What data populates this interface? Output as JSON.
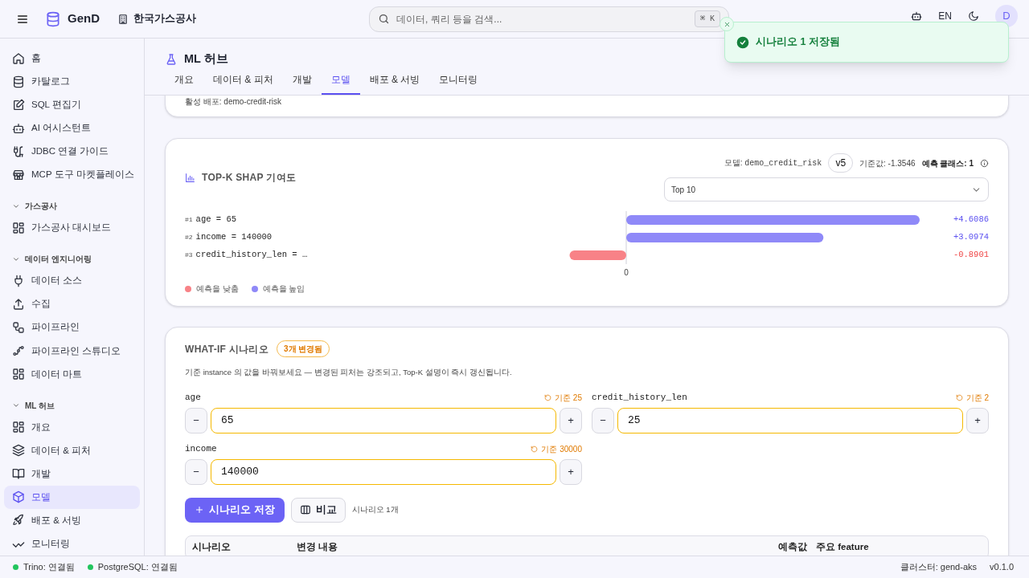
{
  "topbar": {
    "brand": "GenD",
    "org": "한국가스공사",
    "search": {
      "placeholder": "데이터, 쿼리 등을 검색...",
      "shortcut": "⌘ K"
    },
    "language": "EN",
    "avatar": "D"
  },
  "toast": {
    "message": "시나리오 1 저장됨"
  },
  "sidebar": {
    "items": [
      {
        "label": "홈",
        "selected": false
      },
      {
        "label": "카탈로그",
        "selected": false
      },
      {
        "label": "SQL 편집기",
        "selected": false
      },
      {
        "label": "AI 어시스턴트",
        "selected": false
      },
      {
        "label": "JDBC 연결 가이드",
        "selected": false
      },
      {
        "label": "MCP 도구 마켓플레이스",
        "selected": false
      }
    ],
    "sections": [
      {
        "title": "가스공사",
        "expanded": true,
        "items": [
          {
            "label": "가스공사 대시보드",
            "selected": false
          }
        ]
      },
      {
        "title": "데이터 엔지니어링",
        "expanded": true,
        "items": [
          {
            "label": "데이터 소스",
            "selected": false
          },
          {
            "label": "수집",
            "selected": false
          },
          {
            "label": "파이프라인",
            "selected": false
          },
          {
            "label": "파이프라인 스튜디오",
            "selected": false
          },
          {
            "label": "데이터 마트",
            "selected": false
          }
        ]
      },
      {
        "title": "ML 허브",
        "expanded": true,
        "items": [
          {
            "label": "개요",
            "selected": false
          },
          {
            "label": "데이터 & 피처",
            "selected": false
          },
          {
            "label": "개발",
            "selected": false
          },
          {
            "label": "모델",
            "selected": true
          },
          {
            "label": "배포 & 서빙",
            "selected": false
          },
          {
            "label": "모니터링",
            "selected": false
          }
        ]
      }
    ]
  },
  "page": {
    "title": "ML 허브",
    "tabs": [
      {
        "label": "개요",
        "selected": false
      },
      {
        "label": "데이터 & 피처",
        "selected": false
      },
      {
        "label": "개발",
        "selected": false
      },
      {
        "label": "모델",
        "selected": true
      },
      {
        "label": "배포 & 서빙",
        "selected": false
      },
      {
        "label": "모니터링",
        "selected": false
      }
    ]
  },
  "deployment_card": {
    "text": "활성 배포: demo-credit-risk"
  },
  "shap": {
    "title": "TOP-K SHAP 기여도",
    "model_label": "모델:",
    "model": "demo_credit_risk",
    "version": "v5",
    "baseline": "기준값: -1.3546",
    "predicted_class": "예측 클래스: 1",
    "top_k": "Top 10",
    "ranks": [
      "#1",
      "#2",
      "#3"
    ],
    "chart_data": {
      "type": "bar",
      "orientation": "horizontal",
      "categories": [
        "age = 65",
        "income = 140000",
        "credit_history_len = …"
      ],
      "values": [
        4.6086,
        3.0974,
        -0.8901
      ],
      "value_labels": [
        "+4.6086",
        "+3.0974",
        "-0.8901"
      ]
    },
    "zero_label": "0",
    "legend": [
      {
        "label": "예측을 낮춤",
        "color": "#f88287"
      },
      {
        "label": "예측을 높임",
        "color": "#8f89f8"
      }
    ]
  },
  "what_if": {
    "title": "WHAT-IF 시나리오",
    "badge": "3개 변경됨",
    "description": "기준 instance 의 값을 바꿔보세요 — 변경된 피처는 강조되고, Top-K 설명이 즉시 갱신됩니다.",
    "fields": [
      {
        "name": "age",
        "baseline": "기준 25",
        "value": "65",
        "changed": true
      },
      {
        "name": "credit_history_len",
        "baseline": "기준 2",
        "value": "25",
        "changed": true
      },
      {
        "name": "income",
        "baseline": "기준 30000",
        "value": "140000",
        "changed": true
      }
    ],
    "decrement": "−",
    "increment": "+",
    "save_button": "시나리오 저장",
    "compare_button": "비교",
    "count": "시나리오 1개",
    "table": {
      "columns": [
        "시나리오",
        "변경 내용",
        "예측값",
        "주요 feature"
      ]
    }
  },
  "status_bar": {
    "connections": [
      {
        "label": "Trino: 연결됨",
        "color": "#22c55e"
      },
      {
        "label": "PostgreSQL: 연결됨",
        "color": "#22c55e"
      }
    ],
    "cluster": "클러스터: gend-aks",
    "version": "v0.1.0"
  }
}
